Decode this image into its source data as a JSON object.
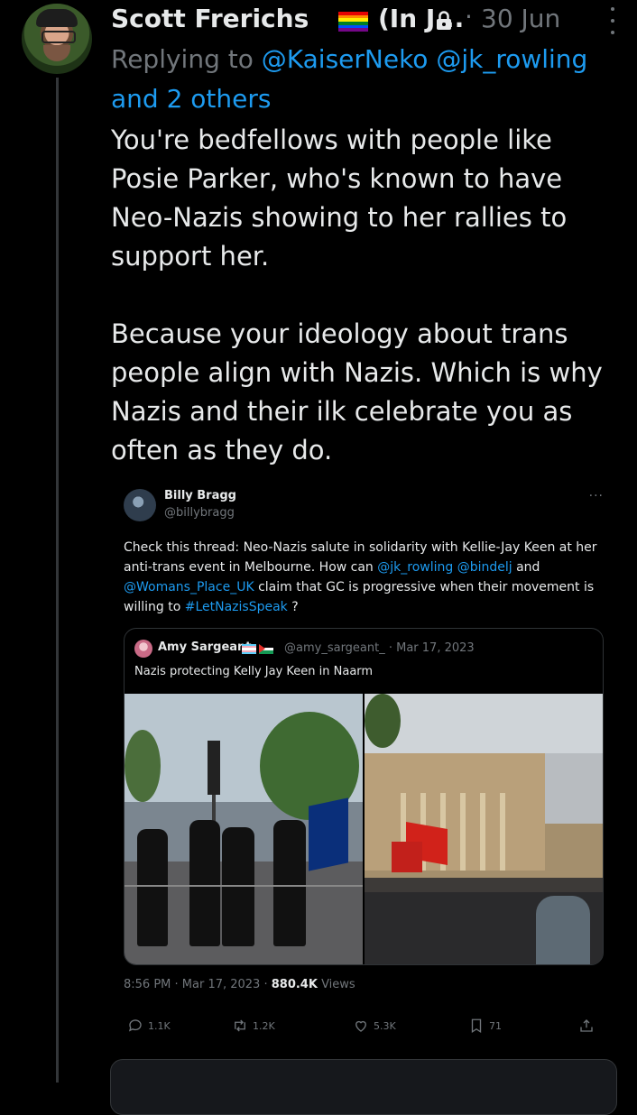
{
  "reply_tweet": {
    "author_name": "Scott Frerichs",
    "author_name_suffix": "(In J...",
    "date": "30 Jun",
    "replying_prefix": "Replying to",
    "replying_handles": "@KaiserNeko @jk_rowling",
    "replying_others": "and 2 others",
    "text_paragraph_1": "You're bedfellows with people like Posie Parker, who's known to have Neo-Nazis showing to her rallies to support her.",
    "text_paragraph_2": "Because your ideology about trans people align with Nazis. Which is why Nazis and their ilk celebrate you as often as they do.",
    "icons": [
      "rainbow-flag-icon",
      "lock-icon",
      "more-options-icon"
    ]
  },
  "embedded_tweet": {
    "author_name": "Billy Bragg",
    "author_handle": "@billybragg",
    "more": "···",
    "text_1": "Check this thread: Neo-Nazis salute in solidarity with Kellie-Jay Keen at her anti-trans event in Melbourne. How can ",
    "mention_1": "@jk_rowling",
    "mention_2": "@bindelj",
    "text_2": " and ",
    "mention_3": "@Womans_Place_UK",
    "text_3": " claim that GC is progressive when their movement is willing to ",
    "hashtag": "#LetNazisSpeak",
    "text_4": " ?",
    "timestamp": "8:56 PM · Mar 17, 2023 · ",
    "views_count": "880.4K",
    "views_label": " Views",
    "stats": {
      "replies": "1.1K",
      "reposts": "1.2K",
      "likes": "5.3K",
      "bookmarks": "71"
    }
  },
  "quoted_tweet": {
    "author_name": "Amy Sargeant",
    "meta": "@amy_sargeant_ · Mar 17, 2023",
    "text": "Nazis protecting Kelly Jay Keen in Naarm",
    "photos": [
      "protesters-with-australian-flag-photo",
      "crowd-with-red-flags-at-parliament-photo"
    ]
  },
  "colors": {
    "background": "#000000",
    "text": "#e7e9ea",
    "secondary": "#71767b",
    "link": "#1d9bf0",
    "border": "#2f3336"
  }
}
